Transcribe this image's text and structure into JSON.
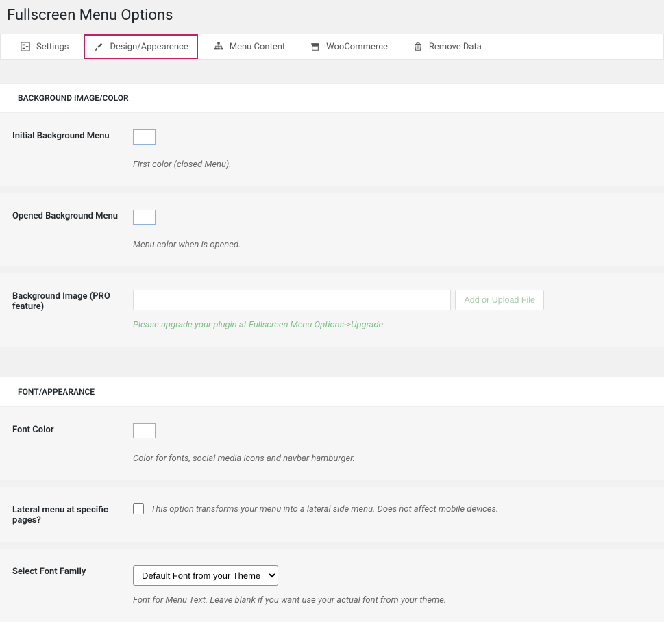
{
  "page": {
    "title": "Fullscreen Menu Options"
  },
  "tabs": {
    "settings": "Settings",
    "design": "Design/Appearence",
    "menu_content": "Menu Content",
    "woocommerce": "WooCommerce",
    "remove_data": "Remove Data"
  },
  "sections": {
    "background": "BACKGROUND IMAGE/COLOR",
    "font": "FONT/APPEARANCE"
  },
  "fields": {
    "initial_bg": {
      "label": "Initial Background Menu",
      "help": "First color (closed Menu)."
    },
    "opened_bg": {
      "label": "Opened Background Menu",
      "help": "Menu color when is opened."
    },
    "bg_image": {
      "label": "Background Image (PRO feature)",
      "button": "Add or Upload File",
      "help": "Please upgrade your plugin at Fullscreen Menu Options->Upgrade"
    },
    "font_color": {
      "label": "Font Color",
      "help": "Color for fonts, social media icons and navbar hamburger."
    },
    "lateral": {
      "label": "Lateral menu at specific pages?",
      "help": "This option transforms your menu into a lateral side menu. Does not affect mobile devices."
    },
    "font_family": {
      "label": "Select Font Family",
      "selected": "Default Font from your Theme",
      "help": "Font for Menu Text. Leave blank if you want use your actual font from your theme."
    }
  }
}
